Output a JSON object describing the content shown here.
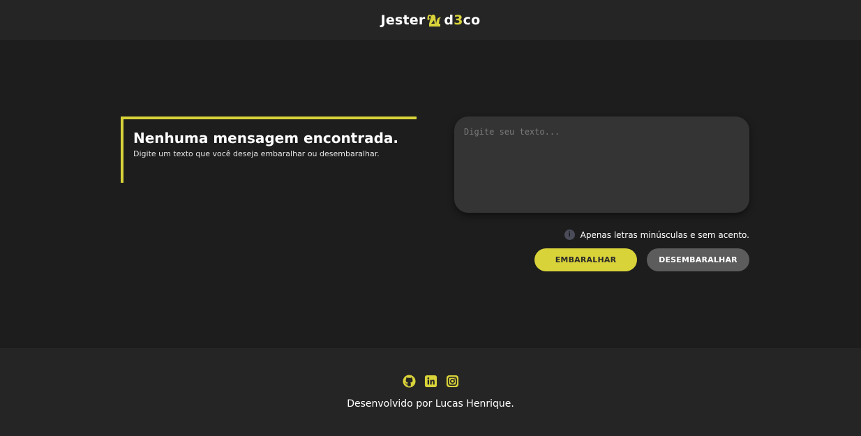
{
  "header": {
    "logo_left": "Jester",
    "logo_mid": "d",
    "logo_accent": "3",
    "logo_right": "co",
    "hat_icon": "jester-hat-icon"
  },
  "message": {
    "title": "Nenhuma mensagem encontrada.",
    "subtitle": "Digite um texto que você deseja embaralhar ou desembaralhar."
  },
  "input": {
    "value": "",
    "placeholder": "Digite seu texto..."
  },
  "hint": {
    "icon": "info-icon",
    "text": "Apenas letras minúsculas e sem acento."
  },
  "actions": {
    "encrypt_label": "EMBARALHAR",
    "decrypt_label": "DESEMBARALHAR"
  },
  "footer": {
    "social_icons": [
      "github-icon",
      "linkedin-icon",
      "instagram-icon"
    ],
    "credit": "Desenvolvido por Lucas Henrique."
  },
  "colors": {
    "accent": "#d9d33a",
    "background": "#1d1d1d",
    "bar": "#252525",
    "input_bg": "#343434",
    "secondary_button": "#5c5c5c"
  }
}
